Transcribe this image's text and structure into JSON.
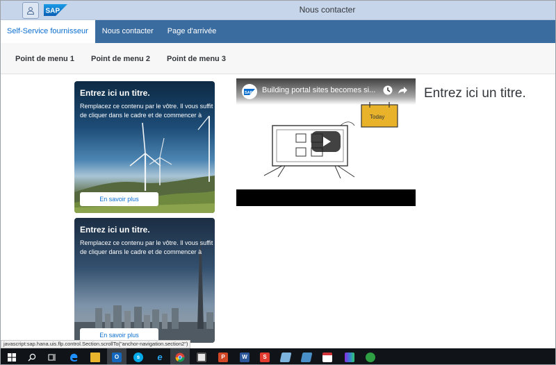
{
  "shell": {
    "title": "Nous contacter",
    "logo_text": "SAP"
  },
  "topnav": {
    "tabs": [
      {
        "label": "Self-Service fournisseur",
        "active": true
      },
      {
        "label": "Nous contacter",
        "active": false
      },
      {
        "label": "Page d'arrivée",
        "active": false
      }
    ]
  },
  "submenu": {
    "items": [
      "Point de menu 1",
      "Point de menu 2",
      "Point de menu 3"
    ]
  },
  "cards": [
    {
      "title": "Entrez ici un titre.",
      "text": "Remplacez ce contenu par le vôtre. Il vous suffit de cliquer dans le cadre et de commencer à",
      "button": "En savoir plus"
    },
    {
      "title": "Entrez ici un titre.",
      "text": "Remplacez ce contenu par le vôtre. Il vous suffit de cliquer dans le cadre et de commencer à",
      "button": "En savoir plus"
    }
  ],
  "video": {
    "title": "Building portal sites becomes si...",
    "channel_logo": "SAP",
    "sign_text": "Today"
  },
  "right_title": "Entrez ici un titre.",
  "statusbar": "javascript:sap.hana.uis.flp.control.Section.scrollTo(\"anchor-navigation.section2\")",
  "taskbar": {
    "icons": [
      "windows-start-icon",
      "search-icon",
      "task-view-icon",
      "edge-icon",
      "file-explorer-icon",
      "outlook-icon",
      "skype-icon",
      "internet-explorer-icon",
      "chrome-icon",
      "app-icon",
      "powerpoint-icon",
      "word-icon",
      "app-s-icon",
      "app-blue-icon",
      "app-teal-icon",
      "calendar-icon",
      "app-purple-icon",
      "app-green-icon"
    ],
    "word_glyph": "W",
    "ppt_glyph": "P",
    "s_glyph": "S",
    "outlook_glyph": "O"
  },
  "colors": {
    "shell_bg": "#c7d5ea",
    "nav_bg": "#3b6ca0",
    "link_blue": "#0a6ed1",
    "taskbar_bg": "#101419"
  }
}
